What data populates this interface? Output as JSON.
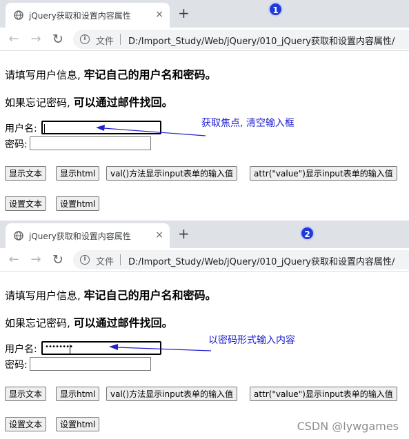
{
  "panels": [
    {
      "step": "1",
      "tab": {
        "title": "jQuery获取和设置内容属性",
        "close": "×",
        "new_tab": "+"
      },
      "toolbar": {
        "file_label": "文件",
        "url": "D:/Import_Study/Web/jQuery/010_jQuery获取和设置内容属性/"
      },
      "intro": {
        "text": "请填写用户信息,",
        "emphasis": "牢记自己的用户名和密码。"
      },
      "recover": {
        "text": "如果忘记密码,",
        "emphasis": "可以通过邮件找回。"
      },
      "form": {
        "username_label": "用户名:",
        "username_value": "",
        "password_label": "密码:",
        "password_value": ""
      },
      "annotation": "获取焦点, 清空输入框",
      "buttons_row1": [
        "显示文本",
        "显示html",
        "val()方法显示input表单的输入值",
        "attr(\"value\")显示input表单的输入值"
      ],
      "buttons_row2": [
        "设置文本",
        "设置html"
      ]
    },
    {
      "step": "2",
      "tab": {
        "title": "jQuery获取和设置内容属性",
        "close": "×",
        "new_tab": "+"
      },
      "toolbar": {
        "file_label": "文件",
        "url": "D:/Import_Study/Web/jQuery/010_jQuery获取和设置内容属性/"
      },
      "intro": {
        "text": "请填写用户信息,",
        "emphasis": "牢记自己的用户名和密码。"
      },
      "recover": {
        "text": "如果忘记密码,",
        "emphasis": "可以通过邮件找回。"
      },
      "form": {
        "username_label": "用户名:",
        "username_value": "••••••••",
        "password_label": "密码:",
        "password_value": ""
      },
      "annotation": "以密码形式输入内容",
      "buttons_row1": [
        "显示文本",
        "显示html",
        "val()方法显示input表单的输入值",
        "attr(\"value\")显示input表单的输入值"
      ],
      "buttons_row2": [
        "设置文本",
        "设置html"
      ]
    }
  ],
  "watermark": "CSDN @lywgames",
  "colors": {
    "annotation": "#2020d0",
    "badge": "#1f3ad6",
    "tabbar": "#dee1e6"
  },
  "icons": [
    "globe-icon",
    "close-icon",
    "plus-icon",
    "back-arrow-icon",
    "forward-arrow-icon",
    "reload-icon",
    "info-icon"
  ]
}
